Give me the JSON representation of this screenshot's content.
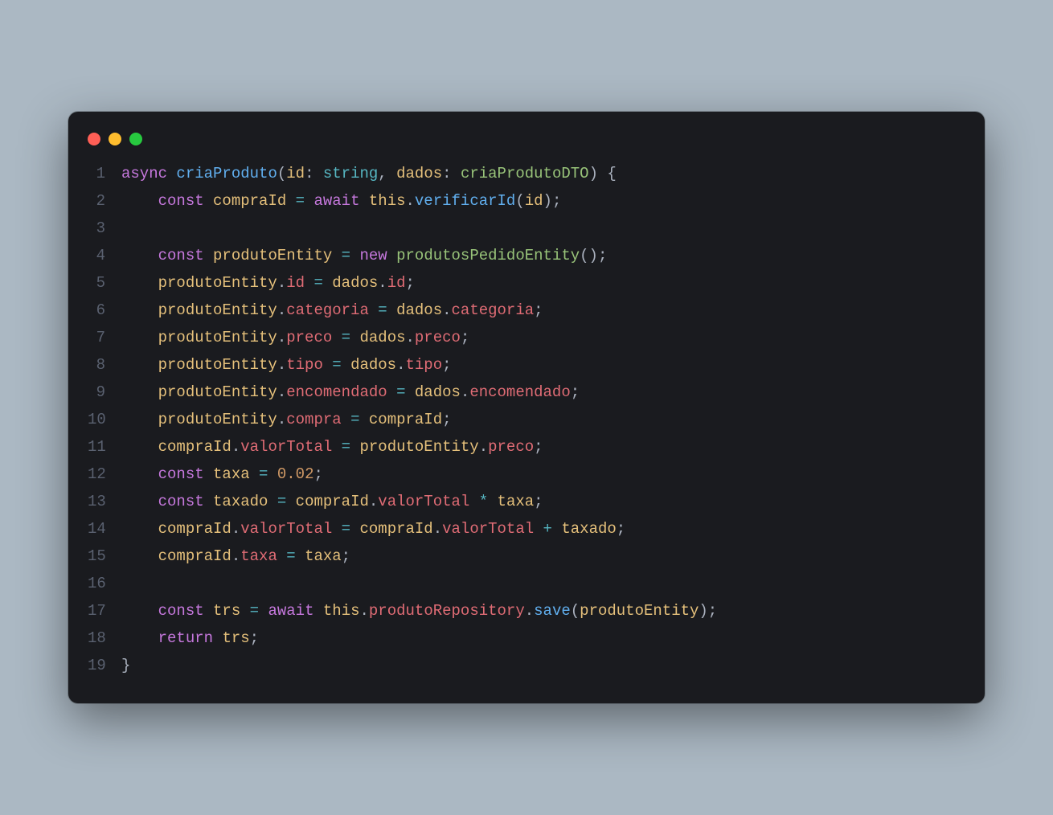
{
  "window": {
    "traffic_lights": [
      "red",
      "yellow",
      "green"
    ]
  },
  "code": {
    "language": "typescript",
    "lines": [
      {
        "n": 1,
        "indent": 0,
        "tokens": [
          {
            "t": "async",
            "c": "kw"
          },
          {
            "t": " "
          },
          {
            "t": "criaProduto",
            "c": "fn"
          },
          {
            "t": "("
          },
          {
            "t": "id",
            "c": "var"
          },
          {
            "t": ": "
          },
          {
            "t": "string",
            "c": "type"
          },
          {
            "t": ", "
          },
          {
            "t": "dados",
            "c": "var"
          },
          {
            "t": ": "
          },
          {
            "t": "criaProdutoDTO",
            "c": "cls"
          },
          {
            "t": ") {"
          }
        ]
      },
      {
        "n": 2,
        "indent": 1,
        "tokens": [
          {
            "t": "const",
            "c": "kw"
          },
          {
            "t": " "
          },
          {
            "t": "compraId",
            "c": "var"
          },
          {
            "t": " "
          },
          {
            "t": "=",
            "c": "op"
          },
          {
            "t": " "
          },
          {
            "t": "await",
            "c": "kw"
          },
          {
            "t": " "
          },
          {
            "t": "this",
            "c": "this"
          },
          {
            "t": "."
          },
          {
            "t": "verificarId",
            "c": "fn"
          },
          {
            "t": "("
          },
          {
            "t": "id",
            "c": "var"
          },
          {
            "t": ");"
          }
        ]
      },
      {
        "n": 3,
        "indent": 0,
        "tokens": []
      },
      {
        "n": 4,
        "indent": 1,
        "tokens": [
          {
            "t": "const",
            "c": "kw"
          },
          {
            "t": " "
          },
          {
            "t": "produtoEntity",
            "c": "var"
          },
          {
            "t": " "
          },
          {
            "t": "=",
            "c": "op"
          },
          {
            "t": " "
          },
          {
            "t": "new",
            "c": "kw"
          },
          {
            "t": " "
          },
          {
            "t": "produtosPedidoEntity",
            "c": "cls"
          },
          {
            "t": "();"
          }
        ]
      },
      {
        "n": 5,
        "indent": 1,
        "tokens": [
          {
            "t": "produtoEntity",
            "c": "var"
          },
          {
            "t": "."
          },
          {
            "t": "id",
            "c": "prop"
          },
          {
            "t": " "
          },
          {
            "t": "=",
            "c": "op"
          },
          {
            "t": " "
          },
          {
            "t": "dados",
            "c": "var"
          },
          {
            "t": "."
          },
          {
            "t": "id",
            "c": "prop"
          },
          {
            "t": ";"
          }
        ]
      },
      {
        "n": 6,
        "indent": 1,
        "tokens": [
          {
            "t": "produtoEntity",
            "c": "var"
          },
          {
            "t": "."
          },
          {
            "t": "categoria",
            "c": "prop"
          },
          {
            "t": " "
          },
          {
            "t": "=",
            "c": "op"
          },
          {
            "t": " "
          },
          {
            "t": "dados",
            "c": "var"
          },
          {
            "t": "."
          },
          {
            "t": "categoria",
            "c": "prop"
          },
          {
            "t": ";"
          }
        ]
      },
      {
        "n": 7,
        "indent": 1,
        "tokens": [
          {
            "t": "produtoEntity",
            "c": "var"
          },
          {
            "t": "."
          },
          {
            "t": "preco",
            "c": "prop"
          },
          {
            "t": " "
          },
          {
            "t": "=",
            "c": "op"
          },
          {
            "t": " "
          },
          {
            "t": "dados",
            "c": "var"
          },
          {
            "t": "."
          },
          {
            "t": "preco",
            "c": "prop"
          },
          {
            "t": ";"
          }
        ]
      },
      {
        "n": 8,
        "indent": 1,
        "tokens": [
          {
            "t": "produtoEntity",
            "c": "var"
          },
          {
            "t": "."
          },
          {
            "t": "tipo",
            "c": "prop"
          },
          {
            "t": " "
          },
          {
            "t": "=",
            "c": "op"
          },
          {
            "t": " "
          },
          {
            "t": "dados",
            "c": "var"
          },
          {
            "t": "."
          },
          {
            "t": "tipo",
            "c": "prop"
          },
          {
            "t": ";"
          }
        ]
      },
      {
        "n": 9,
        "indent": 1,
        "tokens": [
          {
            "t": "produtoEntity",
            "c": "var"
          },
          {
            "t": "."
          },
          {
            "t": "encomendado",
            "c": "prop"
          },
          {
            "t": " "
          },
          {
            "t": "=",
            "c": "op"
          },
          {
            "t": " "
          },
          {
            "t": "dados",
            "c": "var"
          },
          {
            "t": "."
          },
          {
            "t": "encomendado",
            "c": "prop"
          },
          {
            "t": ";"
          }
        ]
      },
      {
        "n": 10,
        "indent": 1,
        "tokens": [
          {
            "t": "produtoEntity",
            "c": "var"
          },
          {
            "t": "."
          },
          {
            "t": "compra",
            "c": "prop"
          },
          {
            "t": " "
          },
          {
            "t": "=",
            "c": "op"
          },
          {
            "t": " "
          },
          {
            "t": "compraId",
            "c": "var"
          },
          {
            "t": ";"
          }
        ]
      },
      {
        "n": 11,
        "indent": 1,
        "tokens": [
          {
            "t": "compraId",
            "c": "var"
          },
          {
            "t": "."
          },
          {
            "t": "valorTotal",
            "c": "prop"
          },
          {
            "t": " "
          },
          {
            "t": "=",
            "c": "op"
          },
          {
            "t": " "
          },
          {
            "t": "produtoEntity",
            "c": "var"
          },
          {
            "t": "."
          },
          {
            "t": "preco",
            "c": "prop"
          },
          {
            "t": ";"
          }
        ]
      },
      {
        "n": 12,
        "indent": 1,
        "tokens": [
          {
            "t": "const",
            "c": "kw"
          },
          {
            "t": " "
          },
          {
            "t": "taxa",
            "c": "var"
          },
          {
            "t": " "
          },
          {
            "t": "=",
            "c": "op"
          },
          {
            "t": " "
          },
          {
            "t": "0.02",
            "c": "num"
          },
          {
            "t": ";"
          }
        ]
      },
      {
        "n": 13,
        "indent": 1,
        "tokens": [
          {
            "t": "const",
            "c": "kw"
          },
          {
            "t": " "
          },
          {
            "t": "taxado",
            "c": "var"
          },
          {
            "t": " "
          },
          {
            "t": "=",
            "c": "op"
          },
          {
            "t": " "
          },
          {
            "t": "compraId",
            "c": "var"
          },
          {
            "t": "."
          },
          {
            "t": "valorTotal",
            "c": "prop"
          },
          {
            "t": " "
          },
          {
            "t": "*",
            "c": "op"
          },
          {
            "t": " "
          },
          {
            "t": "taxa",
            "c": "var"
          },
          {
            "t": ";"
          }
        ]
      },
      {
        "n": 14,
        "indent": 1,
        "tokens": [
          {
            "t": "compraId",
            "c": "var"
          },
          {
            "t": "."
          },
          {
            "t": "valorTotal",
            "c": "prop"
          },
          {
            "t": " "
          },
          {
            "t": "=",
            "c": "op"
          },
          {
            "t": " "
          },
          {
            "t": "compraId",
            "c": "var"
          },
          {
            "t": "."
          },
          {
            "t": "valorTotal",
            "c": "prop"
          },
          {
            "t": " "
          },
          {
            "t": "+",
            "c": "op"
          },
          {
            "t": " "
          },
          {
            "t": "taxado",
            "c": "var"
          },
          {
            "t": ";"
          }
        ]
      },
      {
        "n": 15,
        "indent": 1,
        "tokens": [
          {
            "t": "compraId",
            "c": "var"
          },
          {
            "t": "."
          },
          {
            "t": "taxa",
            "c": "prop"
          },
          {
            "t": " "
          },
          {
            "t": "=",
            "c": "op"
          },
          {
            "t": " "
          },
          {
            "t": "taxa",
            "c": "var"
          },
          {
            "t": ";"
          }
        ]
      },
      {
        "n": 16,
        "indent": 0,
        "tokens": []
      },
      {
        "n": 17,
        "indent": 1,
        "tokens": [
          {
            "t": "const",
            "c": "kw"
          },
          {
            "t": " "
          },
          {
            "t": "trs",
            "c": "var"
          },
          {
            "t": " "
          },
          {
            "t": "=",
            "c": "op"
          },
          {
            "t": " "
          },
          {
            "t": "await",
            "c": "kw"
          },
          {
            "t": " "
          },
          {
            "t": "this",
            "c": "this"
          },
          {
            "t": "."
          },
          {
            "t": "produtoRepository",
            "c": "prop"
          },
          {
            "t": "."
          },
          {
            "t": "save",
            "c": "fn"
          },
          {
            "t": "("
          },
          {
            "t": "produtoEntity",
            "c": "var"
          },
          {
            "t": ");"
          }
        ]
      },
      {
        "n": 18,
        "indent": 1,
        "tokens": [
          {
            "t": "return",
            "c": "kw"
          },
          {
            "t": " "
          },
          {
            "t": "trs",
            "c": "var"
          },
          {
            "t": ";"
          }
        ]
      },
      {
        "n": 19,
        "indent": 0,
        "tokens": [
          {
            "t": "}"
          }
        ]
      }
    ]
  }
}
